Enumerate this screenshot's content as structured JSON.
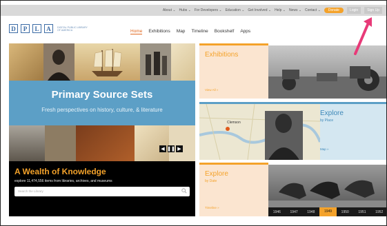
{
  "utility_nav": {
    "items": [
      "About ⌄",
      "Hubs ⌄",
      "For Developers ⌄",
      "Education ⌄",
      "Get Involved ⌄",
      "Help ⌄",
      "News ⌄",
      "Contact ⌄"
    ],
    "donate": "Donate",
    "login": "Login",
    "signup": "Sign Up"
  },
  "logo": {
    "letters": [
      "D",
      "P",
      "L",
      "A"
    ],
    "text_line1": "DIGITAL PUBLIC LIBRARY",
    "text_line2": "OF AMERICA"
  },
  "main_nav": {
    "items": [
      "Home",
      "Exhibitions",
      "Map",
      "Timeline",
      "Bookshelf",
      "Apps"
    ],
    "active": "Home"
  },
  "hero": {
    "title": "Primary Source Sets",
    "subtitle": "Fresh perspectives on history, culture, & literature"
  },
  "wealth": {
    "title": "A Wealth of Knowledge",
    "description": "explore 11,474,556 items from libraries, archives, and museums",
    "search_placeholder": "Search the Library"
  },
  "tiles": {
    "exhibitions": {
      "title": "Exhibitions",
      "more": "View All »"
    },
    "place": {
      "title": "Explore",
      "subtitle": "by Place",
      "more": "Map »",
      "map_label": "Clemson"
    },
    "date": {
      "title": "Explore",
      "subtitle": "by Date",
      "more": "Timeline »"
    }
  },
  "timeline_years": [
    "1946",
    "1947",
    "1948",
    "1949",
    "1950",
    "1951",
    "1952"
  ],
  "selected_year": "1949",
  "colors": {
    "accent_orange": "#f4a22a",
    "accent_blue": "#5c9fc6",
    "annotation_pink": "#e83a78"
  }
}
